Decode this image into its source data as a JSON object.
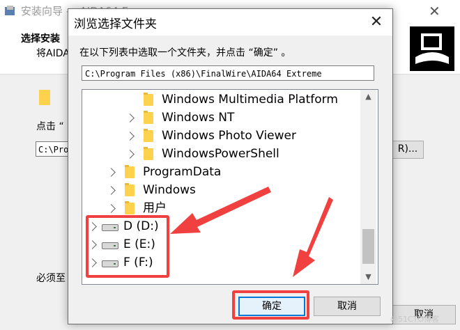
{
  "background_window": {
    "title": "安装向导 — AIDA64 E",
    "header_heading": "选择安装",
    "header_sub": "将AIDA",
    "folder_hint": "点击 “",
    "path_partial": "C:\\Pro",
    "browse_suffix": "R)...",
    "space_note": "必须至",
    "cancel_label": "取消",
    "close_glyph": "✕"
  },
  "dialog": {
    "title": "浏览选择文件夹",
    "close_glyph": "✕",
    "instruction": "在以下列表中选取一个文件夹，并点击 “确定” 。",
    "path_value": "C:\\Program Files (x86)\\FinalWire\\AIDA64 Extreme",
    "tree": [
      {
        "label": "Windows Multimedia Platform",
        "icon": "folder-icon",
        "expandable": false,
        "level": 2
      },
      {
        "label": "Windows NT",
        "icon": "folder-icon",
        "expandable": true,
        "level": 2
      },
      {
        "label": "Windows Photo Viewer",
        "icon": "folder-icon",
        "expandable": true,
        "level": 2
      },
      {
        "label": "WindowsPowerShell",
        "icon": "folder-icon",
        "expandable": true,
        "level": 2
      },
      {
        "label": "ProgramData",
        "icon": "folder-icon",
        "expandable": true,
        "level": 1
      },
      {
        "label": "Windows",
        "icon": "folder-icon",
        "expandable": true,
        "level": 1
      },
      {
        "label": "用户",
        "icon": "folder-icon",
        "expandable": true,
        "level": 1
      },
      {
        "label": "D (D:)",
        "icon": "drive-icon",
        "expandable": true,
        "level": 0
      },
      {
        "label": "E (E:)",
        "icon": "drive-icon",
        "expandable": true,
        "level": 0
      },
      {
        "label": "F (F:)",
        "icon": "drive-icon",
        "expandable": true,
        "level": 0
      }
    ],
    "scroll_up_glyph": "▲",
    "scroll_down_glyph": "▼",
    "ok_label": "确定",
    "cancel_label": "取消"
  },
  "watermark": "@51CTO博客",
  "colors": {
    "annotation_red": "#f04040",
    "ok_border": "#0078d7",
    "folder_yellow": "#ffd24d"
  }
}
